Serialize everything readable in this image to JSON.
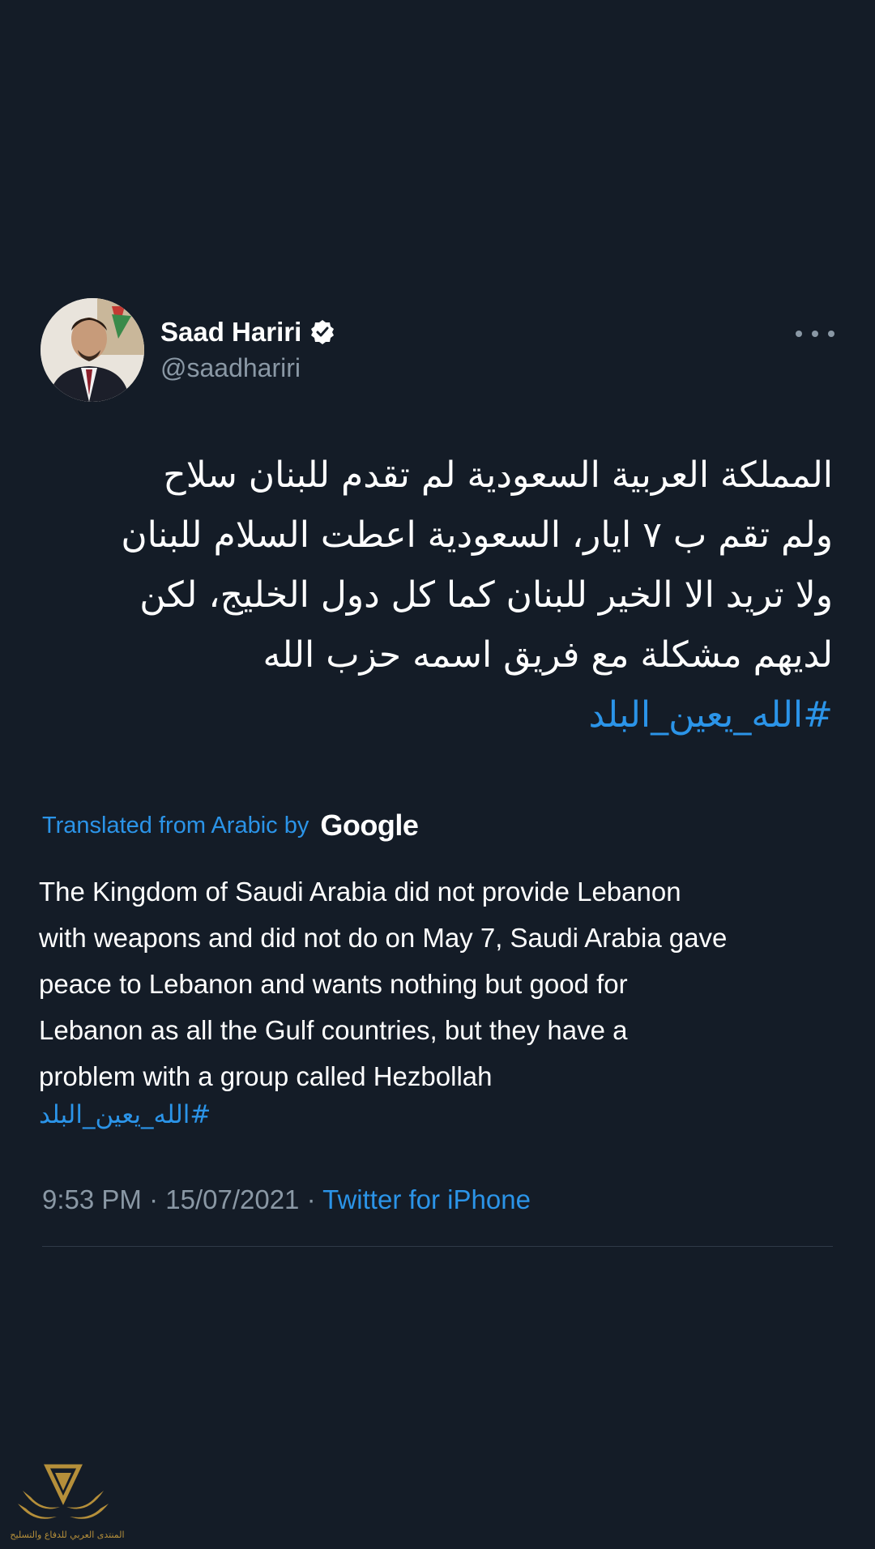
{
  "author": {
    "name": "Saad Hariri",
    "handle": "@saadhariri",
    "verified": true
  },
  "tweet": {
    "arabic_lines": [
      "المملكة العربية السعودية لم تقدم للبنان سلاح",
      "ولم تقم ب ٧ ايار، السعودية اعطت السلام للبنان",
      "ولا تريد الا الخير للبنان كما كل دول الخليج، لكن",
      "لديهم مشكلة مع فريق اسمه حزب الله"
    ],
    "hashtag": "#الله_يعين_البلد"
  },
  "translation": {
    "label": "Translated from Arabic by",
    "provider": "Google",
    "lines": [
      "The Kingdom of Saudi Arabia did not provide Lebanon",
      "with weapons and did not do on May 7, Saudi Arabia gave",
      "peace to Lebanon and wants nothing but good for",
      "Lebanon as all the Gulf countries, but they have a",
      "problem with a group called Hezbollah"
    ],
    "hashtag": "#الله_يعين_البلد"
  },
  "meta": {
    "time": "9:53 PM",
    "separator": " · ",
    "date": "15/07/2021",
    "source": "Twitter for iPhone"
  },
  "watermark": {
    "text": "المنتدى العربي للدفاع والتسليح"
  },
  "colors": {
    "background": "#141c27",
    "link": "#2b94e8",
    "secondary_text": "#8a98a5",
    "primary_text": "#ffffff"
  },
  "icons": {
    "verified": "verified-badge-icon",
    "more": "more-options-icon"
  }
}
